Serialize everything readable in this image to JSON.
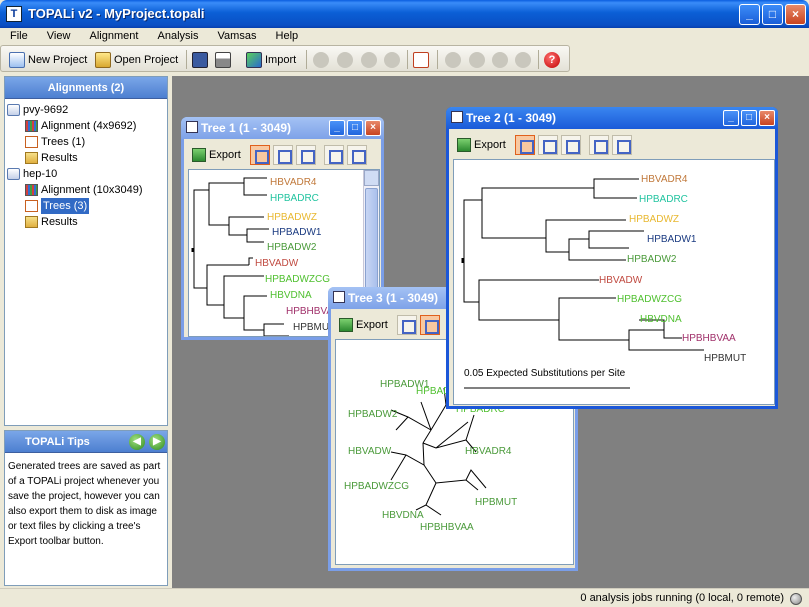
{
  "window": {
    "title": "TOPALi v2 - MyProject.topali",
    "app_icon": "T"
  },
  "menu": [
    "File",
    "View",
    "Alignment",
    "Analysis",
    "Vamsas",
    "Help"
  ],
  "toolbar": {
    "new_project": "New Project",
    "open_project": "Open Project",
    "import": "Import"
  },
  "left_panel": {
    "header": "Alignments (2)",
    "nodes": [
      {
        "label": "pvy-9692",
        "type": "dataset"
      },
      {
        "label": "Alignment (4x9692)",
        "type": "alignment"
      },
      {
        "label": "Trees (1)",
        "type": "trees"
      },
      {
        "label": "Results",
        "type": "results"
      },
      {
        "label": "hep-10",
        "type": "dataset"
      },
      {
        "label": "Alignment (10x3049)",
        "type": "alignment"
      },
      {
        "label": "Trees (3)",
        "type": "trees",
        "selected": true
      },
      {
        "label": "Results",
        "type": "results"
      }
    ]
  },
  "tips": {
    "header": "TOPALi Tips",
    "text": "Generated trees are saved as part of a TOPALi project whenever you save the project, however you can also export them to disk as image or text files by clicking a tree's Export toolbar button."
  },
  "frames": {
    "tree1": {
      "title": "Tree 1 (1 - 3049)",
      "export": "Export",
      "labels": [
        "HBVADR4",
        "HPBADRC",
        "HPBADWZ",
        "HPBADW1",
        "HPBADW2",
        "HBVADW",
        "HPBADWZCG",
        "HBVDNA",
        "HPBHBVA",
        "HPBMUT"
      ]
    },
    "tree2": {
      "title": "Tree 2 (1 - 3049)",
      "export": "Export",
      "labels": [
        "HBVADR4",
        "HPBADRC",
        "HPBADWZ",
        "HPBADW1",
        "HPBADW2",
        "HBVADW",
        "HPBADWZCG",
        "HBVDNA",
        "HPBHBVAA",
        "HPBMUT"
      ],
      "scale": "0.05 Expected Substitutions per Site"
    },
    "tree3": {
      "title": "Tree 3 (1 - 3049)",
      "export": "Export",
      "labels": [
        "HPBADW1",
        "HPBADW2",
        "HPBAD",
        "HPBADRC",
        "HBVADW",
        "HBVADR4",
        "HPBADWZCG",
        "HPBMUT",
        "HBVDNA",
        "HPBHBVAA"
      ]
    }
  },
  "colors": {
    "orange": "#c0783a",
    "teal": "#22c4a0",
    "yellow": "#e8b830",
    "navy": "#1a3a80",
    "green": "#4a9a3a",
    "red": "#c04a40",
    "lime": "#50c030",
    "magenta": "#a0306a",
    "dark": "#333333"
  },
  "status": {
    "text": "0 analysis jobs running (0 local, 0 remote)"
  }
}
